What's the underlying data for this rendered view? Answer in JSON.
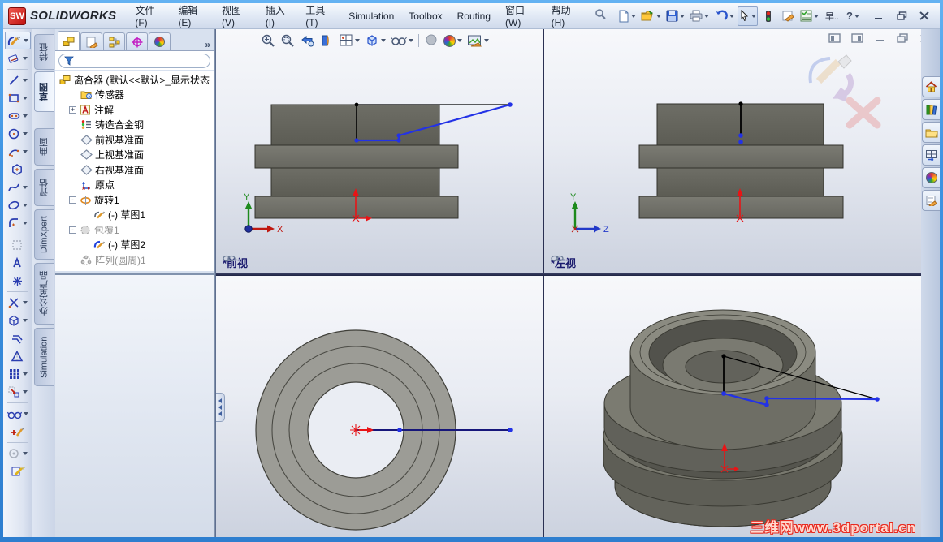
{
  "window": {
    "logo_letters": "SW",
    "brand": "SOLIDWORKS",
    "menus": [
      "文件(F)",
      "编辑(E)",
      "视图(V)",
      "插入(I)",
      "工具(T)",
      "Simulation",
      "Toolbox",
      "Routing",
      "窗口(W)",
      "帮助(H)"
    ]
  },
  "glyphs": {
    "dropdown_note": "dropdown arrows drawn as CSS triangles",
    "help": "?",
    "overflow": "»",
    "plus": "+",
    "minus": "-"
  },
  "quick_toolbar": {
    "icons": [
      "new-document-icon",
      "open-icon",
      "save-icon",
      "print-icon",
      "undo-icon",
      "select-cursor-icon",
      "interference-check-icon",
      "comment-icon",
      "design-checker-icon",
      "screen-capture-icon",
      "help-icon"
    ],
    "truncated_label": "早..",
    "window_buttons": [
      "minimize",
      "restore",
      "close"
    ]
  },
  "command_tabs": {
    "tabs": [
      "特征",
      "草图",
      "曲面",
      "评估",
      "DimXpert",
      "办公室产品",
      "Simulation"
    ],
    "active": "草图"
  },
  "sketch_toolbar_icons": [
    "sketch",
    "smart-dimension",
    "line",
    "rectangle",
    "slot",
    "circle",
    "arc",
    "polygon",
    "spline",
    "ellipse",
    "fillet",
    "sketch-picture",
    "text",
    "point",
    "trim-entities",
    "convert-entities",
    "offset-entities",
    "mirror-entities",
    "linear-sketch-pattern",
    "move-entities",
    "display-relations",
    "add-relation",
    "make-block",
    "rapid-sketch"
  ],
  "feature_panel": {
    "tab_icons": [
      "featuremanager-tab",
      "propertymanager-tab",
      "configurationmanager-tab",
      "dimxpertmanager-tab",
      "displaymanager-tab"
    ],
    "overflow": "»",
    "tree": {
      "root": "离合器 (默认<<默认>_显示状态",
      "items": [
        {
          "label": "传感器",
          "icon": "sensors-folder-icon",
          "expander": "",
          "indent": 1,
          "gray": false
        },
        {
          "label": "注解",
          "icon": "annotations-icon",
          "expander": "+",
          "indent": 1,
          "gray": false
        },
        {
          "label": "铸造合金钢",
          "icon": "material-icon",
          "expander": "",
          "indent": 1,
          "gray": false
        },
        {
          "label": "前视基准面",
          "icon": "plane-icon",
          "expander": "",
          "indent": 1,
          "gray": false
        },
        {
          "label": "上视基准面",
          "icon": "plane-icon",
          "expander": "",
          "indent": 1,
          "gray": false
        },
        {
          "label": "右视基准面",
          "icon": "plane-icon",
          "expander": "",
          "indent": 1,
          "gray": false
        },
        {
          "label": "原点",
          "icon": "origin-icon",
          "expander": "",
          "indent": 1,
          "gray": false
        },
        {
          "label": "旋转1",
          "icon": "revolve-icon",
          "expander": "-",
          "indent": 1,
          "gray": false
        },
        {
          "label": "(-) 草图1",
          "icon": "sketch-icon",
          "expander": "",
          "indent": 2,
          "gray": false
        },
        {
          "label": "包覆1",
          "icon": "wrap-icon",
          "expander": "-",
          "indent": 1,
          "gray": true
        },
        {
          "label": "(-) 草图2",
          "icon": "sketch-active-icon",
          "expander": "",
          "indent": 2,
          "gray": false
        },
        {
          "label": "阵列(圆周)1",
          "icon": "circular-pattern-icon",
          "expander": "",
          "indent": 1,
          "gray": true
        }
      ]
    }
  },
  "headsup_toolbar_icons": [
    "zoom-to-fit",
    "zoom-to-area",
    "previous-view",
    "section-view",
    "view-orientation",
    "display-style",
    "hide-show-items",
    "shadows",
    "edit-appearance",
    "apply-scene"
  ],
  "task_pane_icons": [
    "home",
    "design-library",
    "file-explorer",
    "view-palette",
    "appearances",
    "custom-properties"
  ],
  "viewports": {
    "front": {
      "label": "*前视",
      "axis_v": "Y",
      "axis_h": "X"
    },
    "left": {
      "label": "*左视",
      "axis_v": "Y",
      "axis_h": "Z"
    },
    "top": {
      "label": ""
    },
    "isometric": {
      "label": ""
    }
  },
  "watermark": "三维网www.3dportal.cn",
  "colors": {
    "selection_blue": "#2332e6",
    "sketch_line_navy": "#16167a",
    "origin_red": "#e81416",
    "part_gray": "#6a6a62",
    "part_gray_light": "#9c9c96",
    "viewport_divider": "#2a3052",
    "window_border_blue": "#3f94e2",
    "viewport_label_navy": "#1b1b6e"
  }
}
